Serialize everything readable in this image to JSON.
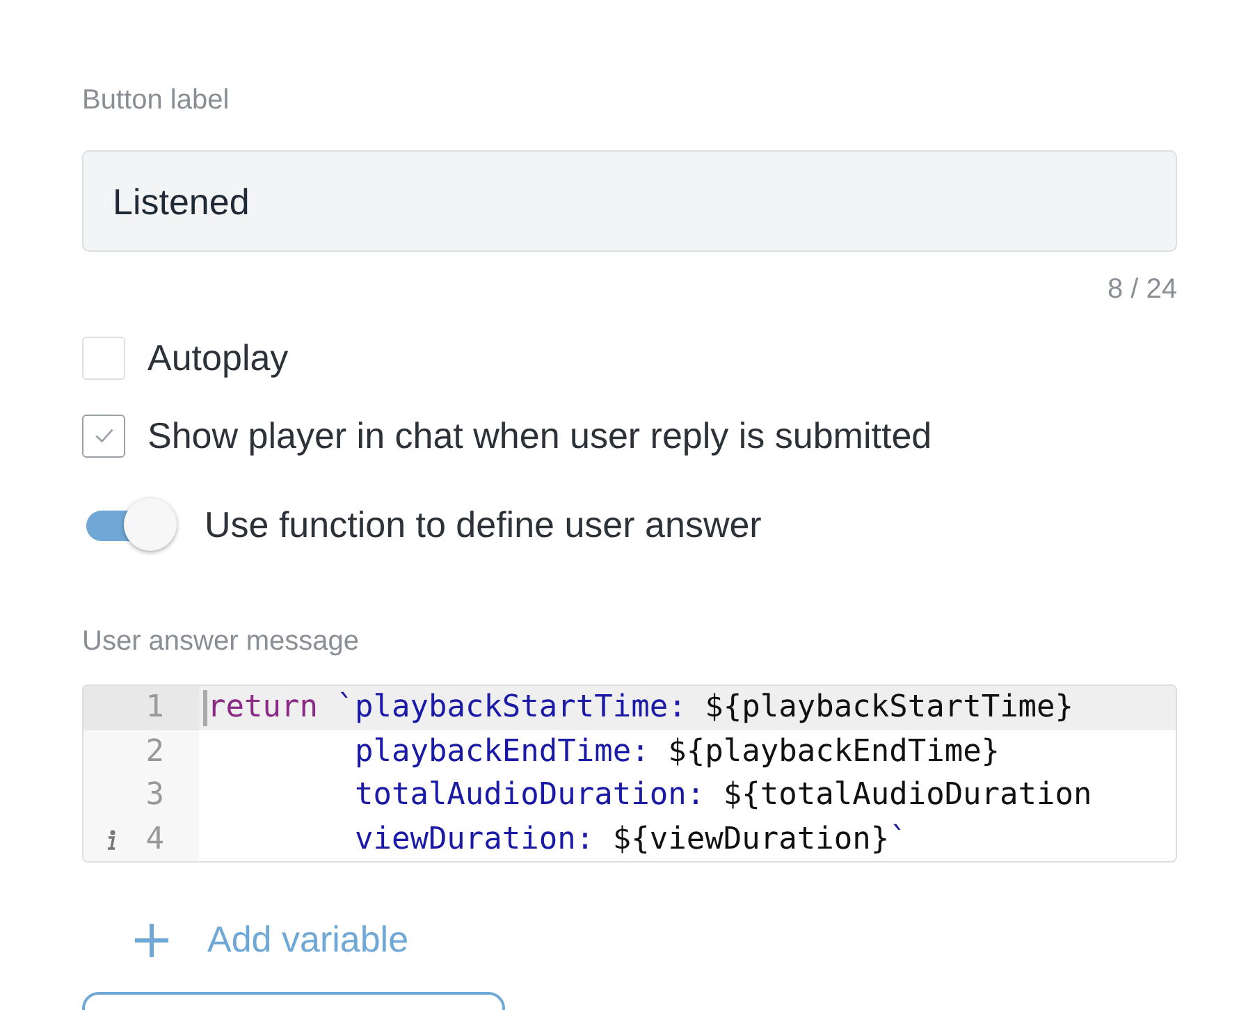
{
  "button_label": {
    "label": "Button label",
    "value": "Listened",
    "counter": "8 / 24"
  },
  "checkboxes": [
    {
      "label": "Autoplay",
      "checked": false
    },
    {
      "label": "Show player in chat when user reply is submitted",
      "checked": true
    }
  ],
  "toggle": {
    "label": "Use function to define user answer",
    "on": true
  },
  "user_answer_message": {
    "label": "User answer message",
    "lines": [
      {
        "number": "1",
        "active": true,
        "info": false,
        "tokens": [
          {
            "kind": "keyword",
            "text": "return"
          },
          {
            "kind": "string",
            "text": " `playbackStartTime: "
          },
          {
            "kind": "plain",
            "text": "${playbackStartTime}"
          }
        ]
      },
      {
        "number": "2",
        "active": false,
        "info": false,
        "tokens": [
          {
            "kind": "string",
            "text": "        playbackEndTime: "
          },
          {
            "kind": "plain",
            "text": "${playbackEndTime}"
          }
        ]
      },
      {
        "number": "3",
        "active": false,
        "info": false,
        "tokens": [
          {
            "kind": "string",
            "text": "        totalAudioDuration: "
          },
          {
            "kind": "plain",
            "text": "${totalAudioDuration"
          }
        ]
      },
      {
        "number": "4",
        "active": false,
        "info": true,
        "tokens": [
          {
            "kind": "string",
            "text": "        viewDuration: "
          },
          {
            "kind": "plain",
            "text": "${viewDuration}"
          },
          {
            "kind": "string",
            "text": "`"
          }
        ]
      }
    ]
  },
  "add_variable": "Add variable"
}
